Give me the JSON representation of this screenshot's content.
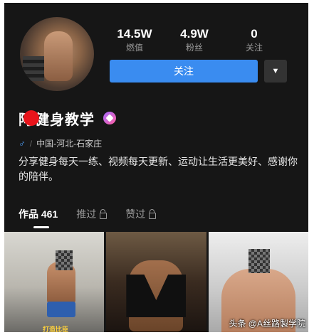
{
  "stats": [
    {
      "value": "14.5W",
      "label": "燃值"
    },
    {
      "value": "4.9W",
      "label": "粉丝"
    },
    {
      "value": "0",
      "label": "关注"
    }
  ],
  "follow_label": "关注",
  "more_icon": "caret-down-icon",
  "profile": {
    "name_prefix": "阿",
    "name_suffix": "健身教学",
    "gender_symbol": "♂",
    "location": "中国-河北-石家庄",
    "bio": "分享健身每天一练、视频每天更新、运动让生活更美好、感谢你的陪伴。"
  },
  "tabs": [
    {
      "label": "作品 461",
      "active": true
    },
    {
      "label": "推过",
      "locked": true
    },
    {
      "label": "赞过",
      "locked": true
    }
  ],
  "thumbnails": [
    {
      "caption": "打造比臣"
    },
    {
      "caption": ""
    },
    {
      "caption": ""
    }
  ],
  "watermark": "头条 @A丝路製学院",
  "colors": {
    "accent": "#3a8cf0",
    "background": "#161616",
    "redaction": "#e8141b"
  }
}
